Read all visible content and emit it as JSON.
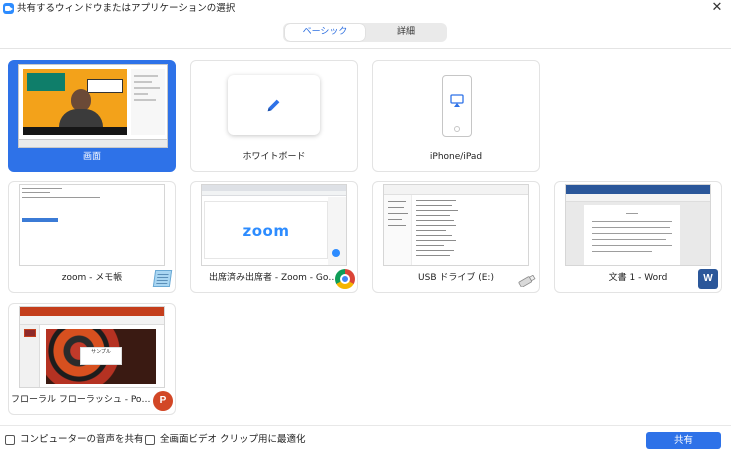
{
  "window": {
    "title": "共有するウィンドウまたはアプリケーションの選択",
    "close_icon": "close-icon",
    "app_icon": "zoom-app-icon"
  },
  "tabs": [
    {
      "label": "ベーシック",
      "selected": true
    },
    {
      "label": "詳細",
      "selected": false
    }
  ],
  "tiles": [
    {
      "label": "画面",
      "selected": true,
      "kind": "screen"
    },
    {
      "label": "ホワイトボード",
      "selected": false,
      "kind": "whiteboard",
      "icon": "pencil-icon"
    },
    {
      "label": "iPhone/iPad",
      "selected": false,
      "kind": "device",
      "icon": "phone-airplay-icon"
    },
    {
      "label": "zoom - メモ帳",
      "selected": false,
      "kind": "window",
      "icon": "notepad-icon"
    },
    {
      "label": "出席済み出席者 - Zoom - Googl...",
      "selected": false,
      "kind": "window",
      "icon": "chrome-icon"
    },
    {
      "label": "USB ドライブ (E:)",
      "selected": false,
      "kind": "window",
      "icon": "usb-drive-icon"
    },
    {
      "label": "文書 1 - Word",
      "selected": false,
      "kind": "window",
      "icon": "word-icon"
    },
    {
      "label": "フローラル フローラッシュ - PowerPoint",
      "selected": false,
      "kind": "window",
      "icon": "powerpoint-icon"
    }
  ],
  "thumbs": {
    "chrome_logo_text": "zoom",
    "ppt_slide_title": "サンプル"
  },
  "footer": {
    "share_audio_label": "コンピューターの音声を共有",
    "optimize_video_label": "全画面ビデオ クリップ用に最適化",
    "share_button_label": "共有"
  },
  "colors": {
    "accent": "#2e72e8",
    "zoom_blue": "#2d8cff"
  }
}
